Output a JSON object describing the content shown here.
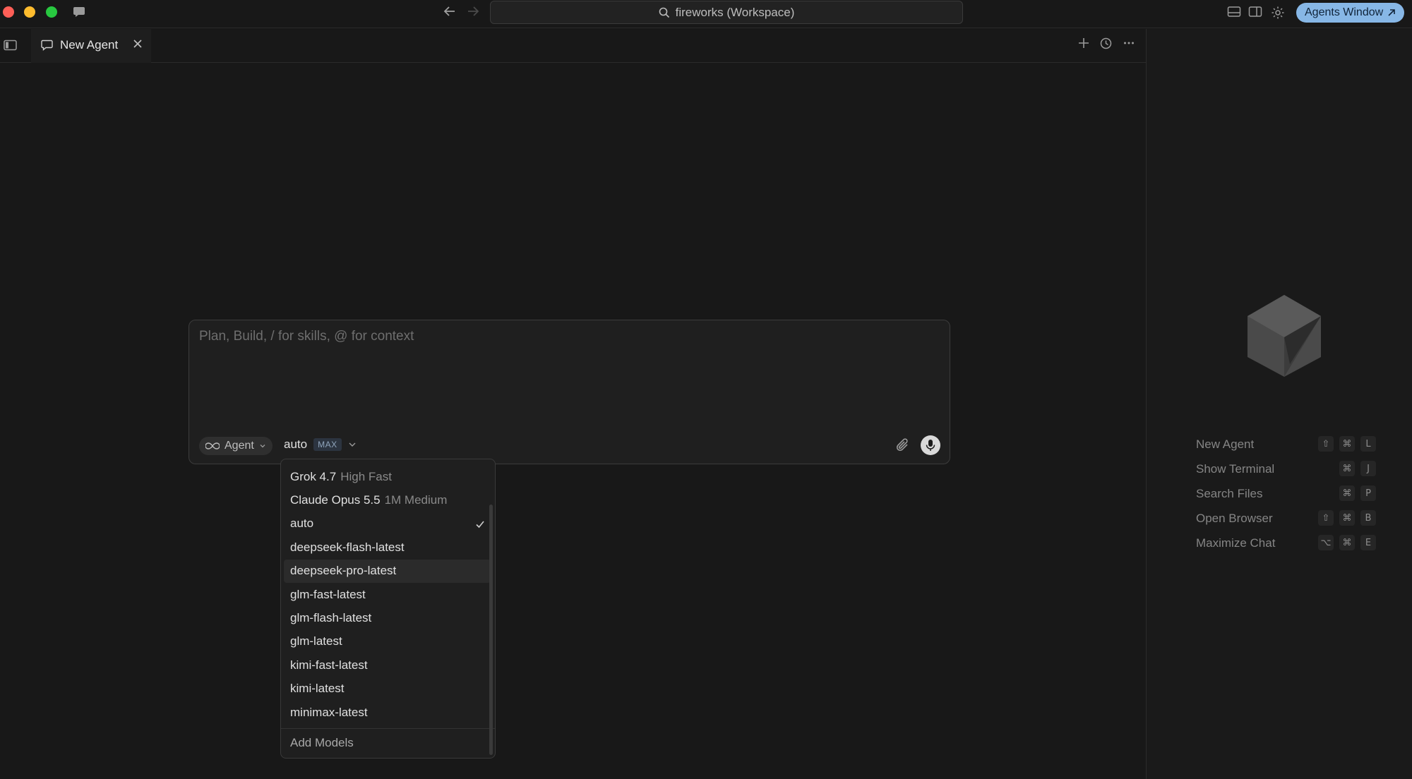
{
  "titlebar": {
    "search_text": "fireworks (Workspace)",
    "agents_window_label": "Agents Window",
    "agents_window_color": "#87b7e6"
  },
  "tabs": [
    {
      "label": "New Agent",
      "icon": "chat-bubble-icon"
    }
  ],
  "composer": {
    "placeholder": "Plan, Build, / for skills, @ for context",
    "mode_label": "Agent",
    "model_label": "auto",
    "max_badge": "MAX"
  },
  "model_dropdown": {
    "items": [
      {
        "name": "Grok 4.7",
        "detail": "High Fast",
        "selected": false
      },
      {
        "name": "Claude Opus 5.5",
        "detail": "1M Medium",
        "selected": false
      },
      {
        "name": "auto",
        "detail": "",
        "selected": true
      },
      {
        "name": "deepseek-flash-latest",
        "detail": "",
        "selected": false
      },
      {
        "name": "deepseek-pro-latest",
        "detail": "",
        "selected": false,
        "hover": true
      },
      {
        "name": "glm-fast-latest",
        "detail": "",
        "selected": false
      },
      {
        "name": "glm-flash-latest",
        "detail": "",
        "selected": false
      },
      {
        "name": "glm-latest",
        "detail": "",
        "selected": false
      },
      {
        "name": "kimi-fast-latest",
        "detail": "",
        "selected": false
      },
      {
        "name": "kimi-latest",
        "detail": "",
        "selected": false
      },
      {
        "name": "minimax-latest",
        "detail": "",
        "selected": false
      }
    ],
    "footer_label": "Add Models"
  },
  "shortcuts": [
    {
      "label": "New Agent",
      "keys": [
        "⇧",
        "⌘",
        "L"
      ]
    },
    {
      "label": "Show Terminal",
      "keys": [
        "",
        "⌘",
        "J"
      ]
    },
    {
      "label": "Search Files",
      "keys": [
        "",
        "⌘",
        "P"
      ]
    },
    {
      "label": "Open Browser",
      "keys": [
        "⇧",
        "⌘",
        "B"
      ]
    },
    {
      "label": "Maximize Chat",
      "keys": [
        "⌥",
        "⌘",
        "E"
      ]
    }
  ]
}
